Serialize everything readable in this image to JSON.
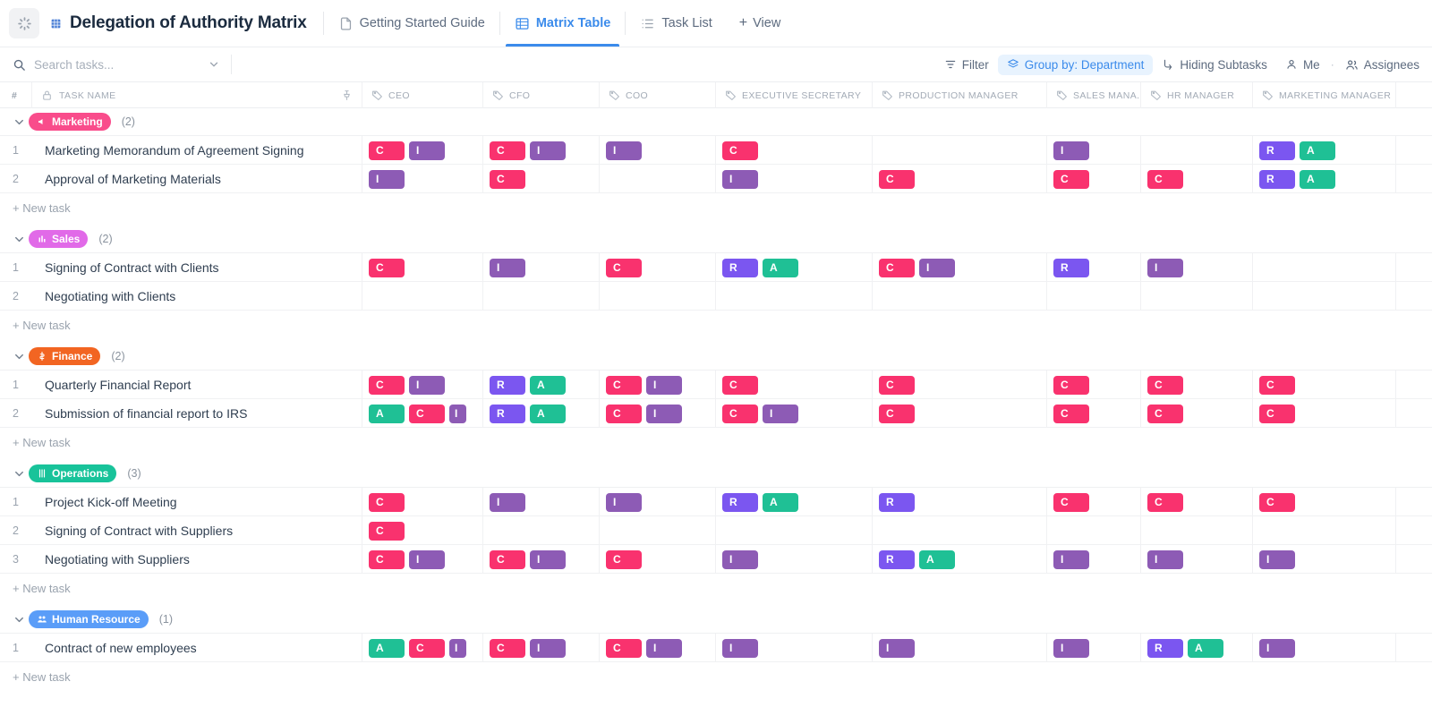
{
  "header": {
    "app_icon": "loading-spinner-icon",
    "doc_icon": "grid-doc-icon",
    "title": "Delegation of Authority Matrix",
    "views": [
      {
        "label": "Getting Started Guide",
        "icon": "doc-icon",
        "active": false
      },
      {
        "label": "Matrix Table",
        "icon": "table-icon",
        "active": true
      },
      {
        "label": "Task List",
        "icon": "list-icon",
        "active": false
      }
    ],
    "add_view_label": "View",
    "add_view_icon": "plus-icon"
  },
  "toolbar": {
    "search_placeholder": "Search tasks...",
    "search_value": "",
    "search_icon": "search-icon",
    "search_chevron_icon": "chevron-down-icon",
    "filter_label": "Filter",
    "filter_icon": "filter-icon",
    "group_by_label": "Group by: Department",
    "group_by_icon": "layers-icon",
    "hiding_subtasks_label": "Hiding Subtasks",
    "hiding_subtasks_icon": "subtask-icon",
    "me_label": "Me",
    "me_icon": "person-icon",
    "assignees_label": "Assignees",
    "assignees_icon": "people-icon",
    "separator_dot": "·",
    "highlight_color": "#3b8beb",
    "highlight_bg": "#e8f3fe"
  },
  "columns": [
    {
      "key": "num",
      "label": "#",
      "icon": null
    },
    {
      "key": "name",
      "label": "TASK NAME",
      "icon": "lock-icon",
      "pin_icon": "pin-icon"
    },
    {
      "key": "ceo",
      "label": "CEO",
      "icon": "tag-icon"
    },
    {
      "key": "cfo",
      "label": "CFO",
      "icon": "tag-icon"
    },
    {
      "key": "coo",
      "label": "COO",
      "icon": "tag-icon"
    },
    {
      "key": "exec_sec",
      "label": "EXECUTIVE SECRETARY",
      "icon": "tag-icon"
    },
    {
      "key": "prod_mgr",
      "label": "PRODUCTION MANAGER",
      "icon": "tag-icon"
    },
    {
      "key": "sales_mgr",
      "label": "SALES MANA..",
      "icon": "tag-icon"
    },
    {
      "key": "hr_mgr",
      "label": "HR MANAGER",
      "icon": "tag-icon"
    },
    {
      "key": "mkt_mgr",
      "label": "MARKETING MANAGER",
      "icon": "tag-icon"
    }
  ],
  "badge_colors": {
    "R": "#7b56f0",
    "A": "#1fc095",
    "C": "#f9326e",
    "I": "#8d5bb5"
  },
  "new_task_label": "+ New task",
  "groups": [
    {
      "name": "Marketing",
      "count": "(2)",
      "color": "#f94c8b",
      "icon": "megaphone-icon",
      "chevron_icon": "chevron-down-icon",
      "tasks": [
        {
          "num": "1",
          "name": "Marketing Memorandum of Agreement Signing",
          "ceo": [
            "C",
            "I"
          ],
          "cfo": [
            "C",
            "I"
          ],
          "coo": [
            "I"
          ],
          "exec_sec": [
            "C"
          ],
          "prod_mgr": [],
          "sales_mgr": [
            "I"
          ],
          "hr_mgr": [],
          "mkt_mgr": [
            "R",
            "A"
          ]
        },
        {
          "num": "2",
          "name": "Approval of Marketing Materials",
          "ceo": [
            "I"
          ],
          "cfo": [
            "C"
          ],
          "coo": [],
          "exec_sec": [
            "I"
          ],
          "prod_mgr": [
            "C"
          ],
          "sales_mgr": [
            "C"
          ],
          "hr_mgr": [
            "C"
          ],
          "mkt_mgr": [
            "R",
            "A"
          ]
        }
      ]
    },
    {
      "name": "Sales",
      "count": "(2)",
      "color": "#e16ae8",
      "icon": "chart-icon",
      "chevron_icon": "chevron-down-icon",
      "tasks": [
        {
          "num": "1",
          "name": "Signing of Contract with Clients",
          "ceo": [
            "C"
          ],
          "cfo": [
            "I"
          ],
          "coo": [
            "C"
          ],
          "exec_sec": [
            "R",
            "A"
          ],
          "prod_mgr": [
            "C",
            "I"
          ],
          "sales_mgr": [
            "R"
          ],
          "hr_mgr": [
            "I"
          ],
          "mkt_mgr": []
        },
        {
          "num": "2",
          "name": "Negotiating with Clients",
          "ceo": [],
          "cfo": [],
          "coo": [],
          "exec_sec": [],
          "prod_mgr": [],
          "sales_mgr": [],
          "hr_mgr": [],
          "mkt_mgr": []
        }
      ]
    },
    {
      "name": "Finance",
      "count": "(2)",
      "color": "#f26522",
      "icon": "money-icon",
      "chevron_icon": "chevron-down-icon",
      "tasks": [
        {
          "num": "1",
          "name": "Quarterly Financial Report",
          "ceo": [
            "C",
            "I"
          ],
          "cfo": [
            "R",
            "A"
          ],
          "coo": [
            "C",
            "I"
          ],
          "exec_sec": [
            "C"
          ],
          "prod_mgr": [
            "C"
          ],
          "sales_mgr": [
            "C"
          ],
          "hr_mgr": [
            "C"
          ],
          "mkt_mgr": [
            "C"
          ]
        },
        {
          "num": "2",
          "name": "Submission of financial report to IRS",
          "ceo": [
            "A",
            "C",
            "I"
          ],
          "cfo": [
            "R",
            "A"
          ],
          "coo": [
            "C",
            "I"
          ],
          "exec_sec": [
            "C",
            "I"
          ],
          "prod_mgr": [
            "C"
          ],
          "sales_mgr": [
            "C"
          ],
          "hr_mgr": [
            "C"
          ],
          "mkt_mgr": [
            "C"
          ]
        }
      ]
    },
    {
      "name": "Operations",
      "count": "(3)",
      "color": "#18c39a",
      "icon": "gear-icon",
      "chevron_icon": "chevron-down-icon",
      "tasks": [
        {
          "num": "1",
          "name": "Project Kick-off Meeting",
          "ceo": [
            "C"
          ],
          "cfo": [
            "I"
          ],
          "coo": [
            "I"
          ],
          "exec_sec": [
            "R",
            "A"
          ],
          "prod_mgr": [
            "R"
          ],
          "sales_mgr": [
            "C"
          ],
          "hr_mgr": [
            "C"
          ],
          "mkt_mgr": [
            "C"
          ]
        },
        {
          "num": "2",
          "name": "Signing of Contract with Suppliers",
          "ceo": [
            "C"
          ],
          "cfo": [],
          "coo": [],
          "exec_sec": [],
          "prod_mgr": [],
          "sales_mgr": [],
          "hr_mgr": [],
          "mkt_mgr": []
        },
        {
          "num": "3",
          "name": "Negotiating with Suppliers",
          "ceo": [
            "C",
            "I"
          ],
          "cfo": [
            "C",
            "I"
          ],
          "coo": [
            "C"
          ],
          "exec_sec": [
            "I"
          ],
          "prod_mgr": [
            "R",
            "A"
          ],
          "sales_mgr": [
            "I"
          ],
          "hr_mgr": [
            "I"
          ],
          "mkt_mgr": [
            "I"
          ]
        }
      ]
    },
    {
      "name": "Human Resource",
      "count": "(1)",
      "color": "#5a9df8",
      "icon": "people-group-icon",
      "chevron_icon": "chevron-down-icon",
      "tasks": [
        {
          "num": "1",
          "name": "Contract of new employees",
          "ceo": [
            "A",
            "C",
            "I"
          ],
          "cfo": [
            "C",
            "I"
          ],
          "coo": [
            "C",
            "I"
          ],
          "exec_sec": [
            "I"
          ],
          "prod_mgr": [
            "I"
          ],
          "sales_mgr": [
            "I"
          ],
          "hr_mgr": [
            "R",
            "A"
          ],
          "mkt_mgr": [
            "I"
          ]
        }
      ]
    }
  ]
}
